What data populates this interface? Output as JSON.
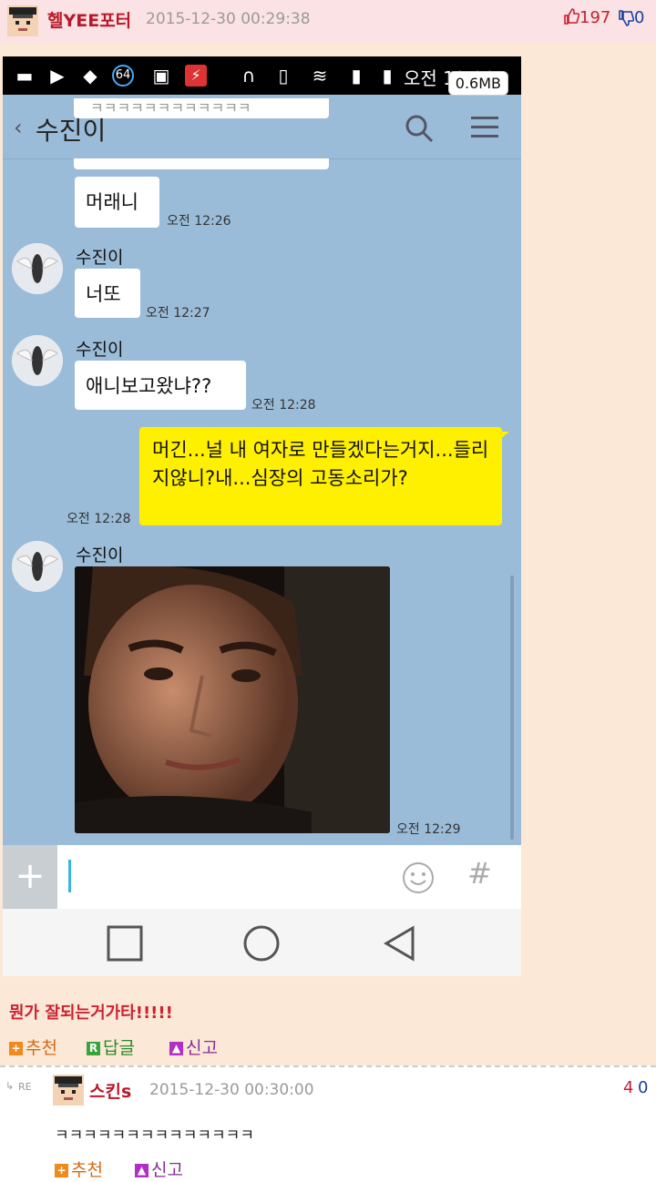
{
  "post": {
    "author": "헬YEE포터",
    "timestamp": "2015-12-30 00:29:38",
    "upvotes": "197",
    "downvotes": "0"
  },
  "screenshot": {
    "status_time": "오전 12:29",
    "size_badge": "0.6MB",
    "chat_title": "수진이",
    "back_glyph": "‹",
    "top_partial": "ㅋㅋㅋㅋㅋㅋㅋㅋㅋㅋㅋㅋ",
    "messages": [
      {
        "side": "me",
        "text": "머래니",
        "time": "오전 12:26"
      },
      {
        "side": "other",
        "sender": "수진이",
        "text": "너또",
        "time": "오전 12:27"
      },
      {
        "side": "other",
        "sender": "수진이",
        "text": "애니보고왔냐??",
        "time": "오전 12:28"
      },
      {
        "side": "me",
        "text": "머긴...널 내 여자로 만들겠다는거지...들리지않니?내...심장의 고동소리가?",
        "time": "오전 12:28"
      },
      {
        "side": "other",
        "sender": "수진이",
        "text": "",
        "time": "오전 12:29"
      }
    ],
    "input_plus": "+",
    "input_hash": "#"
  },
  "comment": {
    "text": "뭔가 잘되는거가타!!!!!",
    "actions": {
      "recommend": "추천",
      "reply": "답글",
      "report": "신고"
    },
    "icons": {
      "recommend": "+",
      "reply": "R"
    }
  },
  "reply_comment": {
    "re_label": "RE",
    "author": "스킨s",
    "timestamp": "2015-12-30 00:30:00",
    "up": "4",
    "down": "0",
    "text": "ㅋㅋㅋㅋㅋㅋㅋㅋㅋㅋㅋㅋㅋㅋ",
    "actions": {
      "recommend": "추천",
      "report": "신고"
    }
  },
  "colors": {
    "accent": "#b8192a",
    "kakao_bg": "#9bbcd8",
    "yellow_bubble": "#fff000"
  }
}
